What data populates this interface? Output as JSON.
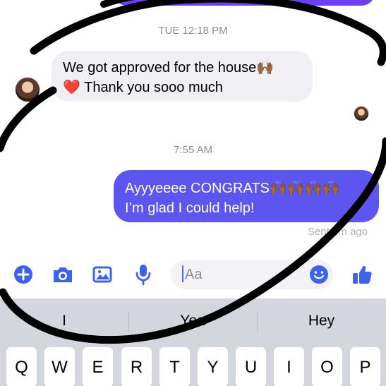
{
  "thread": {
    "timestamp_top": "TUE 12:18 PM",
    "timestamp_bottom": "7:55 AM",
    "incoming_message": {
      "line1": "We got approved for the house🙌🏾",
      "line2": "❤️ Thank you sooo much"
    },
    "outgoing_message": {
      "line1": "Ayyyeeee CONGRATS🙌🏾🙌🏾🙌🏾🙌🏾",
      "line2": "I’m glad I could help!"
    },
    "sent_status": "Sent 2m ago"
  },
  "composer": {
    "placeholder": "Aa",
    "icons": [
      "plus-icon",
      "camera-icon",
      "photo-icon",
      "microphone-icon",
      "emoji-icon",
      "thumbs-up-icon"
    ]
  },
  "keyboard": {
    "suggestions": [
      "I",
      "Yea",
      "Hey"
    ],
    "keys": [
      "Q",
      "W",
      "E",
      "R",
      "T",
      "Y",
      "U",
      "I",
      "O",
      "P"
    ]
  },
  "colors": {
    "accent": "#5d55f0",
    "incoming_bubble": "#efeff4",
    "keyboard_bg": "#d3d6dc",
    "icon_blue": "#3d62f0",
    "marker": "#000000"
  }
}
